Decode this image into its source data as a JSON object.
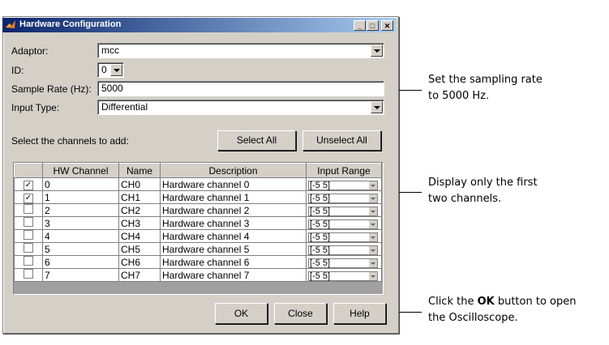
{
  "window": {
    "title": "Hardware Configuration",
    "min_glyph": "_",
    "max_glyph": "□",
    "close_glyph": "✕"
  },
  "form": {
    "adaptor_label": "Adaptor:",
    "adaptor_value": "mcc",
    "id_label": "ID:",
    "id_value": "0",
    "sample_rate_label": "Sample Rate (Hz):",
    "sample_rate_value": "5000",
    "input_type_label": "Input Type:",
    "input_type_value": "Differential"
  },
  "channels": {
    "prompt": "Select the channels to add:",
    "select_all_label": "Select All",
    "unselect_all_label": "Unselect All",
    "columns": [
      "HW Channel",
      "Name",
      "Description",
      "Input Range"
    ],
    "rows": [
      {
        "checked": true,
        "hw": "0",
        "name": "CH0",
        "desc": "Hardware channel 0",
        "range": "[-5 5]"
      },
      {
        "checked": true,
        "hw": "1",
        "name": "CH1",
        "desc": "Hardware channel 1",
        "range": "[-5 5]"
      },
      {
        "checked": false,
        "hw": "2",
        "name": "CH2",
        "desc": "Hardware channel 2",
        "range": "[-5 5]"
      },
      {
        "checked": false,
        "hw": "3",
        "name": "CH3",
        "desc": "Hardware channel 3",
        "range": "[-5 5]"
      },
      {
        "checked": false,
        "hw": "4",
        "name": "CH4",
        "desc": "Hardware channel 4",
        "range": "[-5 5]"
      },
      {
        "checked": false,
        "hw": "5",
        "name": "CH5",
        "desc": "Hardware channel 5",
        "range": "[-5 5]"
      },
      {
        "checked": false,
        "hw": "6",
        "name": "CH6",
        "desc": "Hardware channel 6",
        "range": "[-5 5]"
      },
      {
        "checked": false,
        "hw": "7",
        "name": "CH7",
        "desc": "Hardware channel 7",
        "range": "[-5 5]"
      }
    ]
  },
  "buttons": {
    "ok_label": "OK",
    "close_label": "Close",
    "help_label": "Help"
  },
  "annotations": {
    "rate_line1": "Set the sampling rate",
    "rate_line2": "to 5000 Hz.",
    "channels_line1": "Display only the first",
    "channels_line2": "two channels.",
    "ok_line1_pre": "Click the ",
    "ok_line1_bold": "OK",
    "ok_line1_post": " button to open",
    "ok_line2": "the Oscilloscope."
  }
}
